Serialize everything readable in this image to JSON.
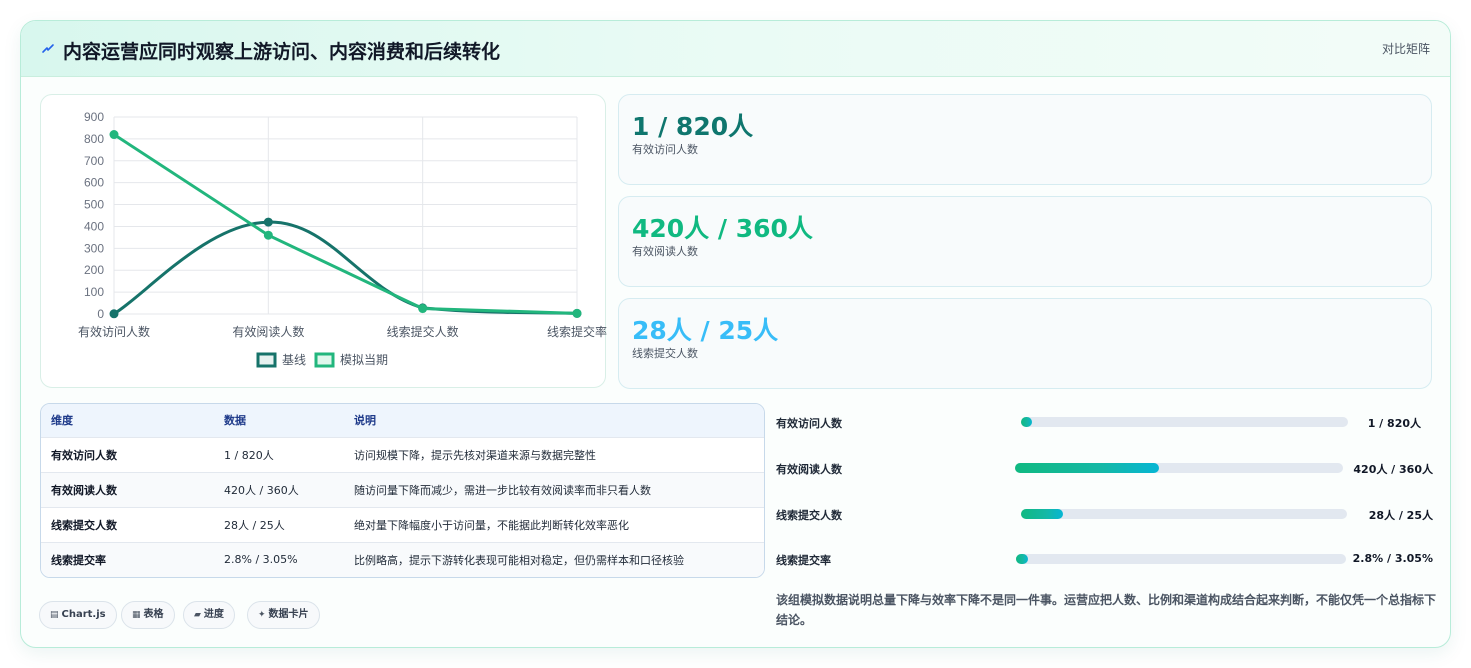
{
  "header": {
    "title": "内容运营应同时观察上游访问、内容消费和后续转化",
    "compare_label": "对比矩阵"
  },
  "colors": {
    "baseline": "#16736a",
    "current": "#22b67d",
    "stat1": "#0f766e",
    "stat2": "#10b981",
    "stat3": "#38bdf8"
  },
  "chart_data": {
    "type": "line",
    "categories": [
      "有效访问人数",
      "有效阅读人数",
      "线索提交人数",
      "线索提交率"
    ],
    "series": [
      {
        "name": "基线",
        "values": [
          1,
          420,
          28,
          2.8
        ]
      },
      {
        "name": "模拟当期",
        "values": [
          820,
          360,
          25,
          3.05
        ]
      }
    ],
    "ylim": [
      0,
      900
    ],
    "yticks": [
      "900",
      "800",
      "700",
      "600",
      "500",
      "400",
      "300",
      "200",
      "100",
      "0"
    ],
    "grid": true,
    "legend": "bottom"
  },
  "stats": [
    {
      "value": "1 / 820人",
      "label": "有效访问人数"
    },
    {
      "value": "420人 / 360人",
      "label": "有效阅读人数"
    },
    {
      "value": "28人 / 25人",
      "label": "线索提交人数"
    }
  ],
  "table": {
    "headers": [
      "维度",
      "数据",
      "说明"
    ],
    "rows": [
      {
        "dim": "有效访问人数",
        "data": "1 / 820人",
        "desc": "访问规模下降，提示先核对渠道来源与数据完整性"
      },
      {
        "dim": "有效阅读人数",
        "data": "420人 / 360人",
        "desc": "随访问量下降而减少，需进一步比较有效阅读率而非只看人数"
      },
      {
        "dim": "线索提交人数",
        "data": "28人 / 25人",
        "desc": "绝对量下降幅度小于访问量，不能据此判断转化效率恶化"
      },
      {
        "dim": "线索提交率",
        "data": "2.8% / 3.05%",
        "desc": "比例略高，提示下游转化表现可能相对稳定，但仍需样本和口径核验"
      }
    ]
  },
  "progress": [
    {
      "label": "有效访问人数",
      "value": "1 / 820人",
      "fraction": 0.02
    },
    {
      "label": "有效阅读人数",
      "value": "420人 / 360人",
      "fraction": 0.44
    },
    {
      "label": "线索提交人数",
      "value": "28人 / 25人",
      "fraction": 0.13
    },
    {
      "label": "线索提交率",
      "value": "2.8% / 3.05%",
      "fraction": 0.02
    }
  ],
  "note": "该组模拟数据说明总量下降与效率下降不是同一件事。运营应把人数、比例和渠道构成结合起来判断，不能仅凭一个总指标下结论。",
  "chips": [
    {
      "icon": "▤",
      "label": "Chart.js"
    },
    {
      "icon": "▦",
      "label": "表格"
    },
    {
      "icon": "▰",
      "label": "进度"
    },
    {
      "icon": "✦",
      "label": "数据卡片"
    }
  ]
}
